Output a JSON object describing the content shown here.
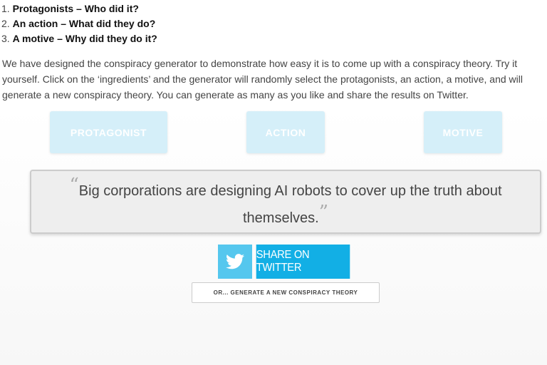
{
  "steps": [
    {
      "num": "1.",
      "text": "Protagonists – Who did it?"
    },
    {
      "num": "2.",
      "text": "An action – What did they do?"
    },
    {
      "num": "3.",
      "text": "A motive – Why did they do it?"
    }
  ],
  "intro": "We have designed the conspiracy generator to demonstrate how easy it is to come up with a conspiracy theory. Try it yourself. Click on the ‘ingredients’ and the generator will randomly select the protagonists, an action, a motive, and will generate a new conspiracy theory. You can generate as many as you like and share the results on Twitter.",
  "ingredients": {
    "protagonist": "PROTAGONIST",
    "action": "ACTION",
    "motive": "MOTIVE"
  },
  "result": {
    "open_quote": "“",
    "text": "Big corporations are designing AI robots to cover up the truth about themselves.",
    "close_quote": "”"
  },
  "share": {
    "label": "SHARE ON TWITTER",
    "icon": "twitter-bird-icon"
  },
  "generate": {
    "label": "OR... GENERATE A NEW CONSPIRACY THEORY"
  },
  "colors": {
    "ingredient_bg": "#d5eff9",
    "twitter_dark": "#12afe5",
    "twitter_light": "#55c7ee"
  }
}
